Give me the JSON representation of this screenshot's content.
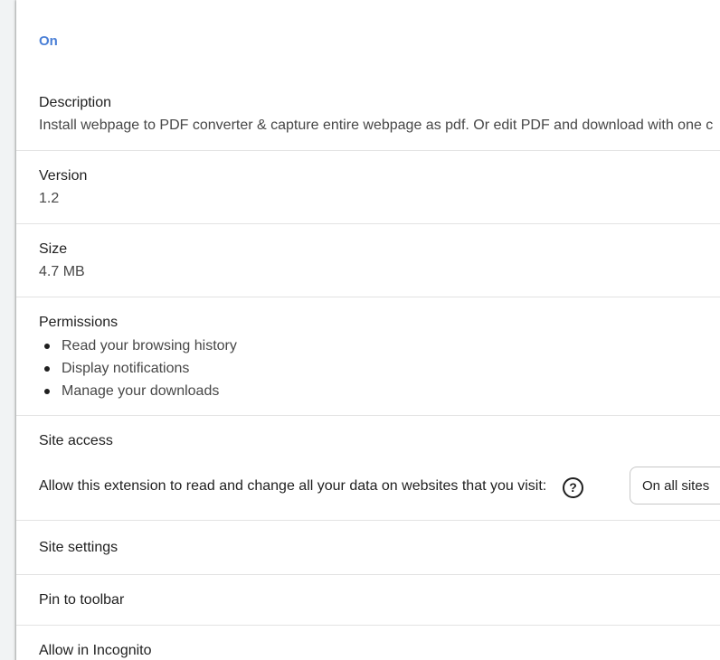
{
  "extension": {
    "status": "On",
    "description_label": "Description",
    "description_text": "Install webpage to PDF converter & capture entire webpage as pdf. Or edit PDF and download with one c",
    "version_label": "Version",
    "version_value": "1.2",
    "size_label": "Size",
    "size_value": "4.7 MB",
    "permissions_label": "Permissions",
    "permissions": [
      "Read your browsing history",
      "Display notifications",
      "Manage your downloads"
    ],
    "site_access": {
      "label": "Site access",
      "prompt": "Allow this extension to read and change all your data on websites that you visit:",
      "help_icon": "?",
      "selected_option": "On all sites"
    },
    "site_settings_label": "Site settings",
    "pin_to_toolbar_label": "Pin to toolbar",
    "allow_incognito_label": "Allow in Incognito"
  },
  "colors": {
    "status_blue": "#4a7fd6",
    "divider": "#e3e3e3",
    "text_primary": "#1f1f1f",
    "text_secondary": "#474747"
  }
}
